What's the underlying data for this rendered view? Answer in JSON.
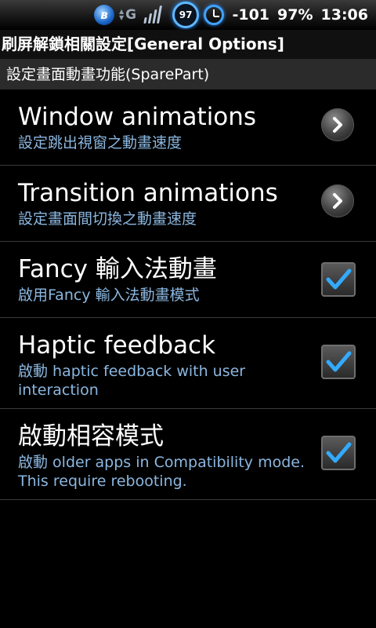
{
  "status_bar": {
    "network_type": "G",
    "battery_ring_value": "97",
    "signal_strength": "-101",
    "battery_percent": "97%",
    "time": "13:06",
    "bluetooth_icon": "bluetooth-icon",
    "wifi_icon": "wifi-signal-icon",
    "alarm_icon": "alarm-clock-icon"
  },
  "header": {
    "title": "刷屏解鎖相關設定[General Options]"
  },
  "section": {
    "title": "設定畫面動畫功能(SparePart)"
  },
  "items": [
    {
      "title": "Window animations",
      "summary": "設定跳出視窗之動畫速度",
      "widget": "chevron"
    },
    {
      "title": "Transition animations",
      "summary": "設定畫面間切換之動畫速度",
      "widget": "chevron"
    },
    {
      "title": "Fancy 輸入法動畫",
      "summary": "啟用Fancy 輸入法動畫模式",
      "widget": "checkbox",
      "checked": true
    },
    {
      "title": "Haptic feedback",
      "summary": "啟動 haptic feedback with user interaction",
      "widget": "checkbox",
      "checked": true
    },
    {
      "title": "啟動相容模式",
      "summary": "啟動 older apps in Compatibility mode. This require rebooting.",
      "widget": "checkbox",
      "checked": true
    }
  ],
  "colors": {
    "summary_text": "#8bb7e0",
    "check_mark": "#33aaff",
    "background": "#000000"
  }
}
